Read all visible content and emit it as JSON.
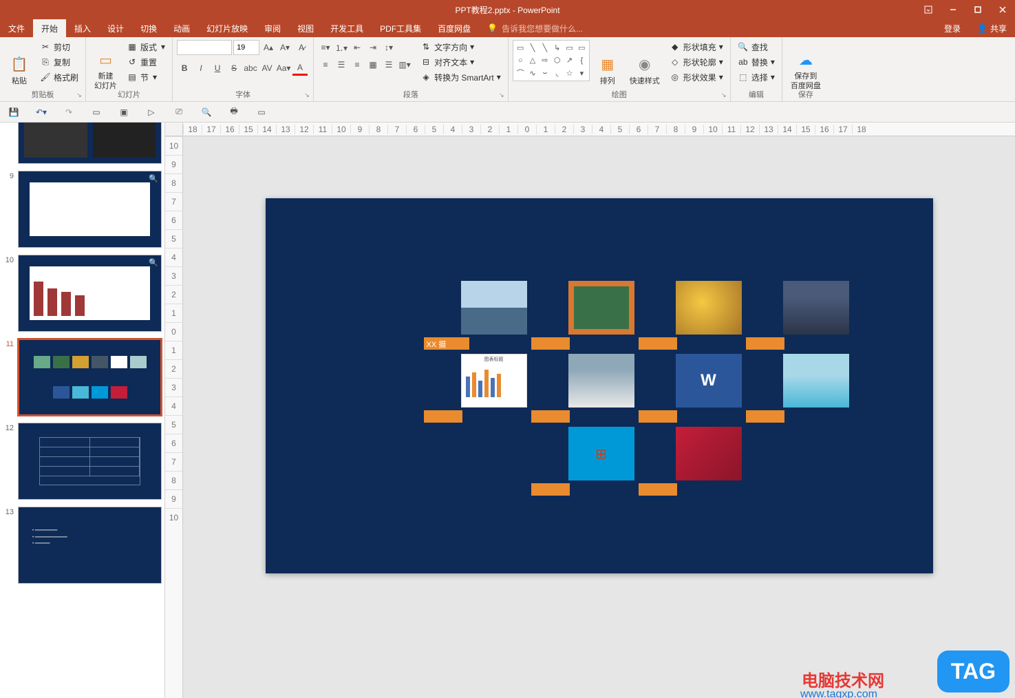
{
  "app": {
    "title": "PPT教程2.pptx - PowerPoint"
  },
  "menu": {
    "file": "文件",
    "home": "开始",
    "insert": "插入",
    "design": "设计",
    "transitions": "切换",
    "animations": "动画",
    "slideshow": "幻灯片放映",
    "review": "审阅",
    "view": "视图",
    "developer": "开发工具",
    "pdf": "PDF工具集",
    "baidu": "百度网盘",
    "tellme": "告诉我您想要做什么...",
    "login": "登录",
    "share": "共享"
  },
  "ribbon": {
    "clipboard": {
      "label": "剪贴板",
      "paste": "粘贴",
      "cut": "剪切",
      "copy": "复制",
      "format_painter": "格式刷"
    },
    "slides": {
      "label": "幻灯片",
      "new_slide": "新建\n幻灯片",
      "layout": "版式",
      "reset": "重置",
      "section": "节"
    },
    "font": {
      "label": "字体",
      "size": "19"
    },
    "paragraph": {
      "label": "段落",
      "text_dir": "文字方向",
      "align_text": "对齐文本",
      "smartart": "转换为 SmartArt"
    },
    "drawing": {
      "label": "绘图",
      "arrange": "排列",
      "quick_styles": "快速样式",
      "shape_fill": "形状填充",
      "shape_outline": "形状轮廓",
      "shape_effects": "形状效果"
    },
    "editing": {
      "label": "编辑",
      "find": "查找",
      "replace": "替换",
      "select": "选择"
    },
    "save": {
      "label": "保存",
      "baidu": "保存到\n百度网盘"
    }
  },
  "slides": {
    "n9": "9",
    "n10": "10",
    "n11": "11",
    "n12": "12",
    "n13": "13"
  },
  "ruler_h": [
    "18",
    "17",
    "16",
    "15",
    "14",
    "13",
    "12",
    "11",
    "10",
    "9",
    "8",
    "7",
    "6",
    "5",
    "4",
    "3",
    "2",
    "1",
    "0",
    "1",
    "2",
    "3",
    "4",
    "5",
    "6",
    "7",
    "8",
    "9",
    "10",
    "11",
    "12",
    "13",
    "14",
    "15",
    "16",
    "17",
    "18"
  ],
  "ruler_v": [
    "10",
    "9",
    "8",
    "7",
    "6",
    "5",
    "4",
    "3",
    "2",
    "1",
    "0",
    "1",
    "2",
    "3",
    "4",
    "5",
    "6",
    "7",
    "8",
    "9",
    "10"
  ],
  "canvas": {
    "caption1": "XX 摄",
    "chart_title": "图表标题"
  },
  "watermark": {
    "text": "电脑技术网",
    "url": "www.tagxp.com",
    "tag": "TAG"
  }
}
